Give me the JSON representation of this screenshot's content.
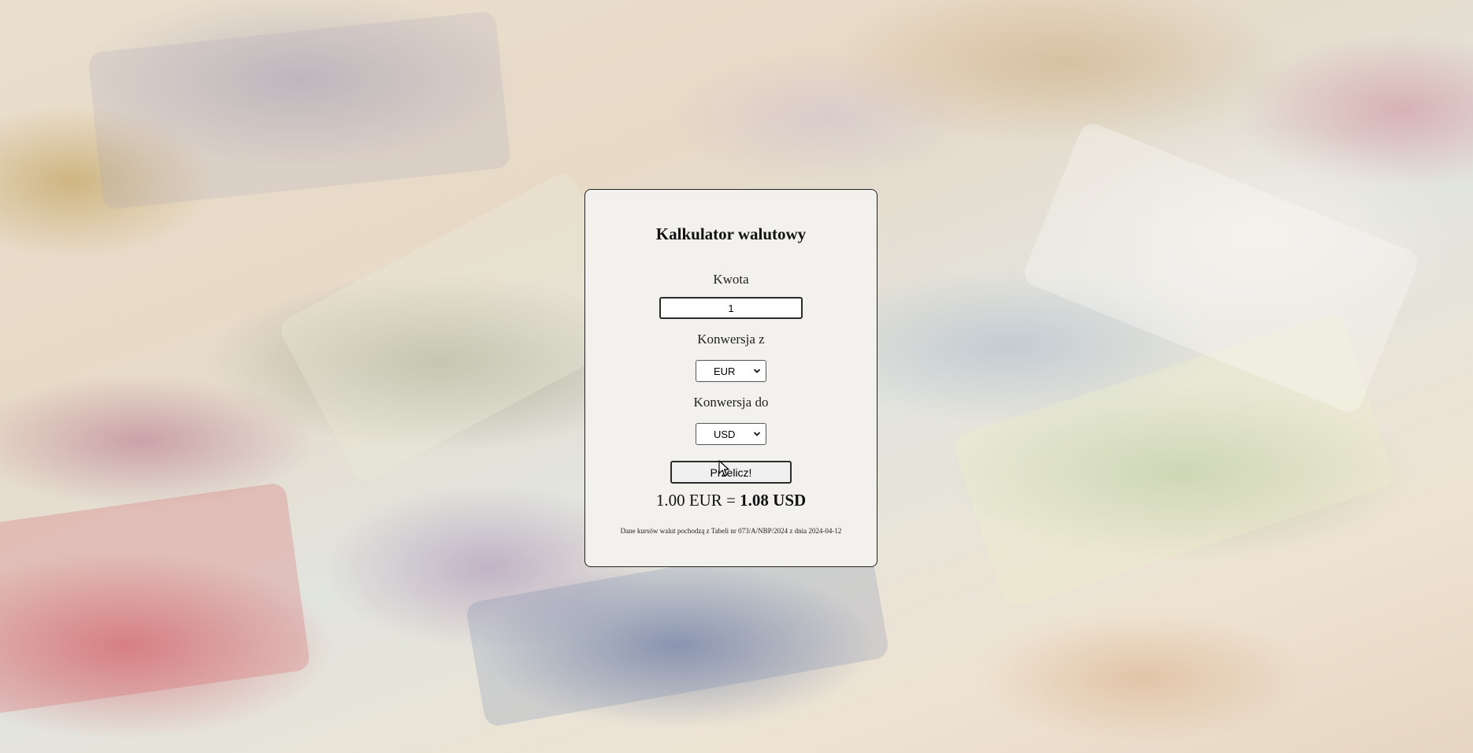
{
  "calculator": {
    "title": "Kalkulator walutowy",
    "amount_label": "Kwota",
    "amount_value": "1",
    "from_label": "Konwersja z",
    "from_value": "EUR",
    "to_label": "Konwersja do",
    "to_value": "USD",
    "calculate_label": "Przelicz!",
    "result_from": "1.00 EUR",
    "result_equals": "=",
    "result_to": "1.08 USD",
    "source_note": "Dane kursów walut pochodzą z Tabeli nr 073/A/NBP/2024 z dnia 2024-04-12"
  },
  "icons": {
    "select_arrow": "chevron-down-icon",
    "mouse_cursor": "cursor-arrow-icon"
  },
  "colors": {
    "card_background": "#f2f1ee",
    "card_border": "#222222",
    "text": "#111111"
  }
}
